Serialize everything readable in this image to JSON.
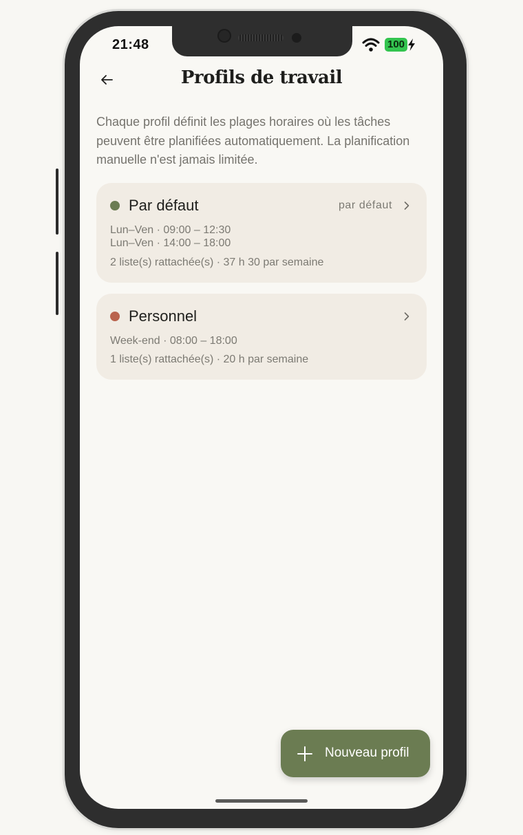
{
  "status_bar": {
    "time": "21:48",
    "battery": "100",
    "wifi_icon": "wifi-icon",
    "charging_icon": "bolt-icon"
  },
  "header": {
    "back_icon": "arrow-left-icon",
    "title": "Profils de travail"
  },
  "intro_text": "Chaque profil définit les plages horaires où les tâches peuvent être planifiées automatiquement. La planification manuelle n'est jamais limitée.",
  "profiles": [
    {
      "name": "Par défaut",
      "color": "#6b7c52",
      "badge": "par défaut",
      "schedules": [
        "Lun–Ven · 09:00 – 12:30",
        "Lun–Ven · 14:00 – 18:00"
      ],
      "summary": "2 liste(s) rattachée(s) · 37 h 30 par semaine"
    },
    {
      "name": "Personnel",
      "color": "#b9634d",
      "badge": "",
      "schedules": [
        "Week-end · 08:00 – 18:00"
      ],
      "summary": "1 liste(s) rattachée(s) · 20 h par semaine"
    }
  ],
  "fab": {
    "icon": "plus-icon",
    "label": "Nouveau profil"
  },
  "colors": {
    "accent": "#6b7c52",
    "card_background": "#f1ece4",
    "screen_background": "#f9f8f4",
    "battery_green": "#33c44f"
  }
}
